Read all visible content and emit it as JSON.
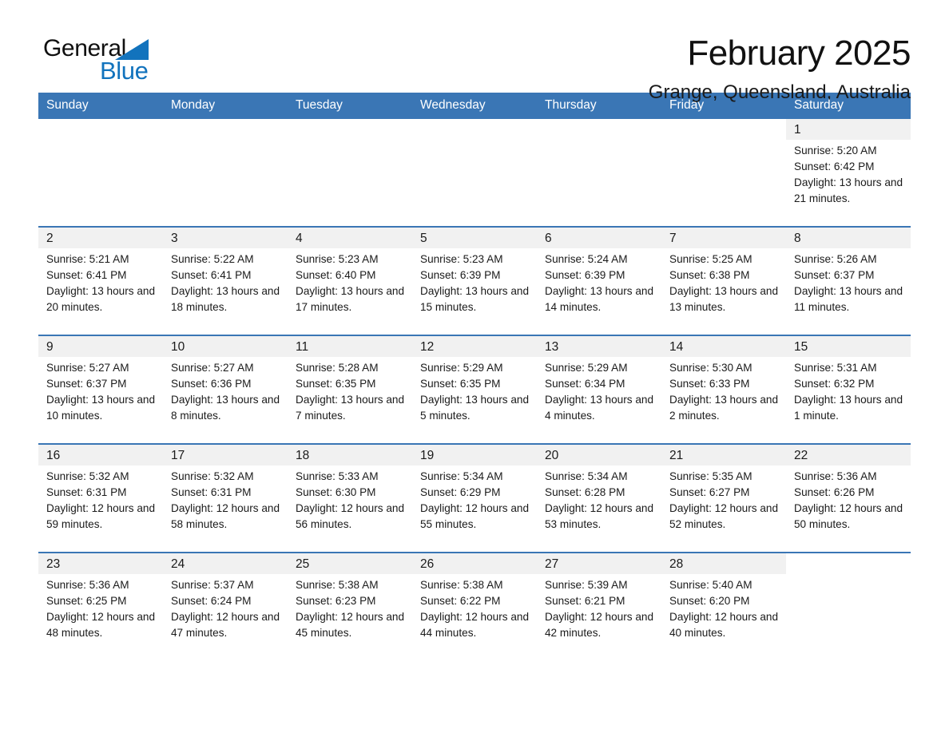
{
  "brand": {
    "name_part1": "General",
    "name_part2": "Blue",
    "accent_color": "#1273bd"
  },
  "header": {
    "title": "February 2025",
    "location": "Grange, Queensland, Australia"
  },
  "theme": {
    "header_blue": "#3a76b5",
    "band_gray": "#f1f1f1"
  },
  "calendar": {
    "weekday_headers": [
      "Sunday",
      "Monday",
      "Tuesday",
      "Wednesday",
      "Thursday",
      "Friday",
      "Saturday"
    ],
    "labels": {
      "sunrise": "Sunrise:",
      "sunset": "Sunset:",
      "daylight": "Daylight:"
    },
    "weeks": [
      [
        {
          "day": "",
          "sunrise": "",
          "sunset": "",
          "daylight": "",
          "blank": true
        },
        {
          "day": "",
          "sunrise": "",
          "sunset": "",
          "daylight": "",
          "blank": true
        },
        {
          "day": "",
          "sunrise": "",
          "sunset": "",
          "daylight": "",
          "blank": true
        },
        {
          "day": "",
          "sunrise": "",
          "sunset": "",
          "daylight": "",
          "blank": true
        },
        {
          "day": "",
          "sunrise": "",
          "sunset": "",
          "daylight": "",
          "blank": true
        },
        {
          "day": "",
          "sunrise": "",
          "sunset": "",
          "daylight": "",
          "blank": true
        },
        {
          "day": "1",
          "sunrise": "Sunrise: 5:20 AM",
          "sunset": "Sunset: 6:42 PM",
          "daylight": "Daylight: 13 hours and 21 minutes."
        }
      ],
      [
        {
          "day": "2",
          "sunrise": "Sunrise: 5:21 AM",
          "sunset": "Sunset: 6:41 PM",
          "daylight": "Daylight: 13 hours and 20 minutes."
        },
        {
          "day": "3",
          "sunrise": "Sunrise: 5:22 AM",
          "sunset": "Sunset: 6:41 PM",
          "daylight": "Daylight: 13 hours and 18 minutes."
        },
        {
          "day": "4",
          "sunrise": "Sunrise: 5:23 AM",
          "sunset": "Sunset: 6:40 PM",
          "daylight": "Daylight: 13 hours and 17 minutes."
        },
        {
          "day": "5",
          "sunrise": "Sunrise: 5:23 AM",
          "sunset": "Sunset: 6:39 PM",
          "daylight": "Daylight: 13 hours and 15 minutes."
        },
        {
          "day": "6",
          "sunrise": "Sunrise: 5:24 AM",
          "sunset": "Sunset: 6:39 PM",
          "daylight": "Daylight: 13 hours and 14 minutes."
        },
        {
          "day": "7",
          "sunrise": "Sunrise: 5:25 AM",
          "sunset": "Sunset: 6:38 PM",
          "daylight": "Daylight: 13 hours and 13 minutes."
        },
        {
          "day": "8",
          "sunrise": "Sunrise: 5:26 AM",
          "sunset": "Sunset: 6:37 PM",
          "daylight": "Daylight: 13 hours and 11 minutes."
        }
      ],
      [
        {
          "day": "9",
          "sunrise": "Sunrise: 5:27 AM",
          "sunset": "Sunset: 6:37 PM",
          "daylight": "Daylight: 13 hours and 10 minutes."
        },
        {
          "day": "10",
          "sunrise": "Sunrise: 5:27 AM",
          "sunset": "Sunset: 6:36 PM",
          "daylight": "Daylight: 13 hours and 8 minutes."
        },
        {
          "day": "11",
          "sunrise": "Sunrise: 5:28 AM",
          "sunset": "Sunset: 6:35 PM",
          "daylight": "Daylight: 13 hours and 7 minutes."
        },
        {
          "day": "12",
          "sunrise": "Sunrise: 5:29 AM",
          "sunset": "Sunset: 6:35 PM",
          "daylight": "Daylight: 13 hours and 5 minutes."
        },
        {
          "day": "13",
          "sunrise": "Sunrise: 5:29 AM",
          "sunset": "Sunset: 6:34 PM",
          "daylight": "Daylight: 13 hours and 4 minutes."
        },
        {
          "day": "14",
          "sunrise": "Sunrise: 5:30 AM",
          "sunset": "Sunset: 6:33 PM",
          "daylight": "Daylight: 13 hours and 2 minutes."
        },
        {
          "day": "15",
          "sunrise": "Sunrise: 5:31 AM",
          "sunset": "Sunset: 6:32 PM",
          "daylight": "Daylight: 13 hours and 1 minute."
        }
      ],
      [
        {
          "day": "16",
          "sunrise": "Sunrise: 5:32 AM",
          "sunset": "Sunset: 6:31 PM",
          "daylight": "Daylight: 12 hours and 59 minutes."
        },
        {
          "day": "17",
          "sunrise": "Sunrise: 5:32 AM",
          "sunset": "Sunset: 6:31 PM",
          "daylight": "Daylight: 12 hours and 58 minutes."
        },
        {
          "day": "18",
          "sunrise": "Sunrise: 5:33 AM",
          "sunset": "Sunset: 6:30 PM",
          "daylight": "Daylight: 12 hours and 56 minutes."
        },
        {
          "day": "19",
          "sunrise": "Sunrise: 5:34 AM",
          "sunset": "Sunset: 6:29 PM",
          "daylight": "Daylight: 12 hours and 55 minutes."
        },
        {
          "day": "20",
          "sunrise": "Sunrise: 5:34 AM",
          "sunset": "Sunset: 6:28 PM",
          "daylight": "Daylight: 12 hours and 53 minutes."
        },
        {
          "day": "21",
          "sunrise": "Sunrise: 5:35 AM",
          "sunset": "Sunset: 6:27 PM",
          "daylight": "Daylight: 12 hours and 52 minutes."
        },
        {
          "day": "22",
          "sunrise": "Sunrise: 5:36 AM",
          "sunset": "Sunset: 6:26 PM",
          "daylight": "Daylight: 12 hours and 50 minutes."
        }
      ],
      [
        {
          "day": "23",
          "sunrise": "Sunrise: 5:36 AM",
          "sunset": "Sunset: 6:25 PM",
          "daylight": "Daylight: 12 hours and 48 minutes."
        },
        {
          "day": "24",
          "sunrise": "Sunrise: 5:37 AM",
          "sunset": "Sunset: 6:24 PM",
          "daylight": "Daylight: 12 hours and 47 minutes."
        },
        {
          "day": "25",
          "sunrise": "Sunrise: 5:38 AM",
          "sunset": "Sunset: 6:23 PM",
          "daylight": "Daylight: 12 hours and 45 minutes."
        },
        {
          "day": "26",
          "sunrise": "Sunrise: 5:38 AM",
          "sunset": "Sunset: 6:22 PM",
          "daylight": "Daylight: 12 hours and 44 minutes."
        },
        {
          "day": "27",
          "sunrise": "Sunrise: 5:39 AM",
          "sunset": "Sunset: 6:21 PM",
          "daylight": "Daylight: 12 hours and 42 minutes."
        },
        {
          "day": "28",
          "sunrise": "Sunrise: 5:40 AM",
          "sunset": "Sunset: 6:20 PM",
          "daylight": "Daylight: 12 hours and 40 minutes."
        },
        {
          "day": "",
          "sunrise": "",
          "sunset": "",
          "daylight": "",
          "blank": true
        }
      ]
    ]
  }
}
